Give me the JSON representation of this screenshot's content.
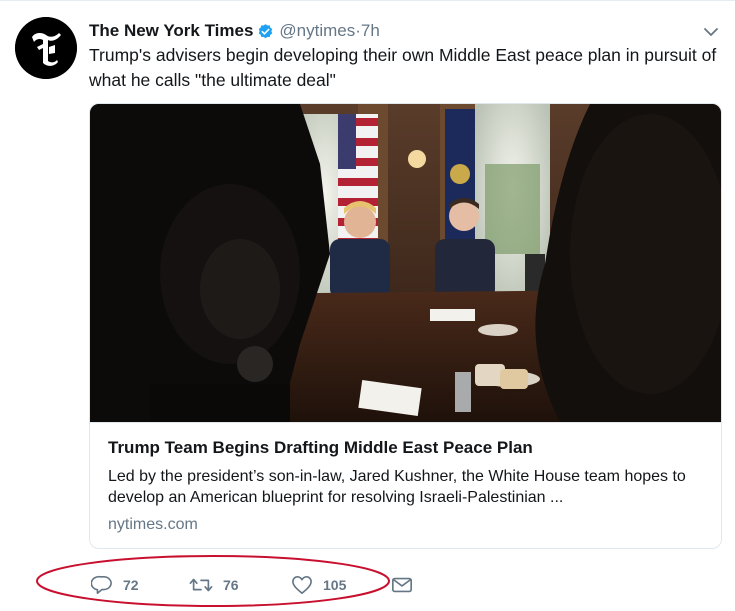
{
  "tweet": {
    "author_name": "The New York Times",
    "author_handle": "@nytimes",
    "timestamp": "·7h",
    "text": "Trump's advisers begin developing their own Middle East peace plan in pursuit of what he calls \"the ultimate deal\"",
    "avatar_icon": "nyt-logo-icon",
    "verified_icon": "verified-badge-icon"
  },
  "card": {
    "title": "Trump Team Begins Drafting Middle East Peace Plan",
    "description": "Led by the president’s son-in-law, Jared Kushner, the White House team hopes to develop an American blueprint for resolving Israeli-Palestinian ...",
    "domain": "nytimes.com"
  },
  "actions": {
    "reply_count": "72",
    "retweet_count": "76",
    "like_count": "105",
    "reply_icon": "reply-icon",
    "retweet_icon": "retweet-icon",
    "like_icon": "heart-icon",
    "dm_icon": "envelope-icon"
  },
  "colors": {
    "verified_blue": "#1da1f2",
    "secondary_text": "#657786",
    "annotation_red": "#c8102e"
  }
}
